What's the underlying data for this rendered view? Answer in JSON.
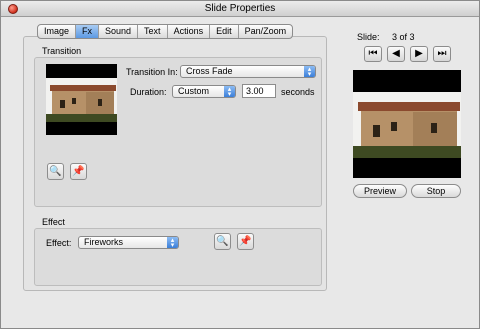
{
  "window": {
    "title": "Slide Properties"
  },
  "tabs": [
    "Image",
    "Fx",
    "Sound",
    "Text",
    "Actions",
    "Edit",
    "Pan/Zoom"
  ],
  "active_tab": "Fx",
  "transition": {
    "section_label": "Transition",
    "transition_in_label": "Transition In:",
    "transition_in_value": "Cross Fade",
    "duration_label": "Duration:",
    "duration_mode": "Custom",
    "duration_value": "3.00",
    "duration_unit": "seconds"
  },
  "effect": {
    "section_label": "Effect",
    "effect_label": "Effect:",
    "effect_value": "Fireworks"
  },
  "slide": {
    "label": "Slide:",
    "counter": "3 of 3"
  },
  "buttons": {
    "preview": "Preview",
    "stop": "Stop"
  },
  "icons": {
    "first": "first-slide-icon",
    "prev": "previous-slide-icon",
    "next": "next-slide-icon",
    "last": "last-slide-icon"
  }
}
